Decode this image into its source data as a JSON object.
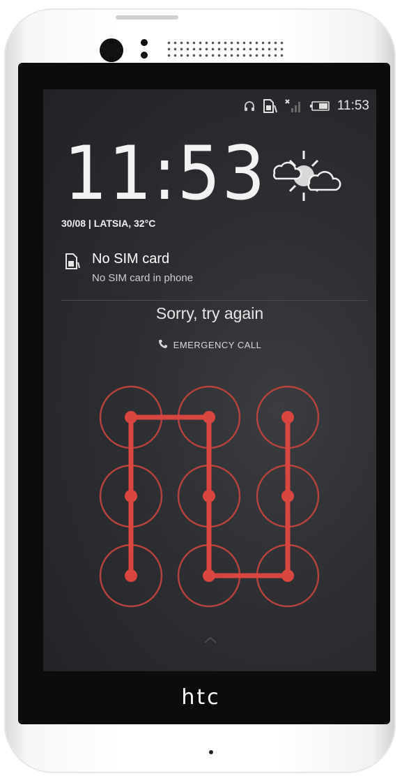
{
  "device": {
    "brand_logo": "htc"
  },
  "status_bar": {
    "time": "11:53",
    "icons": [
      "headset-icon",
      "no-sim-icon",
      "no-signal-icon",
      "battery-icon"
    ]
  },
  "lock_screen": {
    "clock": "11:53",
    "date_location": "30/08 | LATSIA, 32°C",
    "weather_icon": "partly-sunny-icon",
    "notification": {
      "icon": "sim-card-icon",
      "title": "No SIM card",
      "text": "No SIM card in phone"
    },
    "message": "Sorry, try again",
    "emergency_label": "EMERGENCY CALL",
    "pattern_color": "#d9463f"
  }
}
